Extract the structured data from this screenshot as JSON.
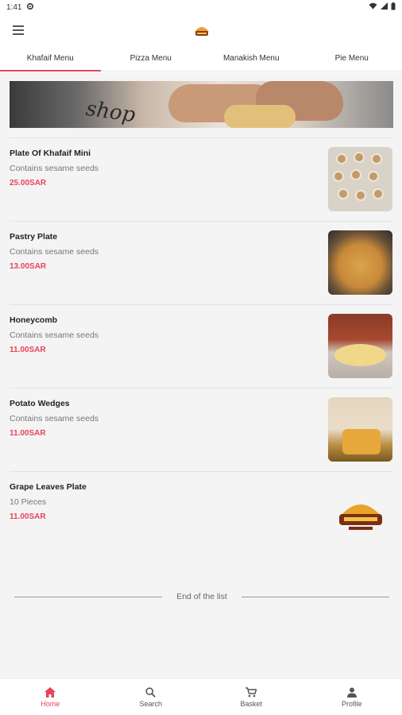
{
  "status_bar": {
    "time": "1:41"
  },
  "tabs": [
    {
      "label": "Khafaif Menu",
      "active": true
    },
    {
      "label": "Pizza Menu",
      "active": false
    },
    {
      "label": "Manakish Menu",
      "active": false
    },
    {
      "label": "Pie Menu",
      "active": false
    }
  ],
  "banner": {
    "text": "shop"
  },
  "items": [
    {
      "name": "Plate Of Khafaif Mini",
      "description": "Contains sesame seeds",
      "price": "25.00SAR",
      "image": "khafaif-plate"
    },
    {
      "name": "Pastry Plate",
      "description": "Contains sesame seeds",
      "price": "13.00SAR",
      "image": "pastry-plate"
    },
    {
      "name": "Honeycomb",
      "description": "Contains sesame seeds",
      "price": "11.00SAR",
      "image": "honeycomb-bread"
    },
    {
      "name": "Potato Wedges",
      "description": "Contains sesame seeds",
      "price": "11.00SAR",
      "image": "potato-wedges-box"
    },
    {
      "name": "Grape Leaves Plate",
      "description": "10 Pieces",
      "price": "11.00SAR",
      "image": "restaurant-logo"
    }
  ],
  "end_of_list": "End of the list",
  "bottom_nav": [
    {
      "label": "Home",
      "icon": "home-icon",
      "active": true
    },
    {
      "label": "Search",
      "icon": "search-icon",
      "active": false
    },
    {
      "label": "Basket",
      "icon": "cart-icon",
      "active": false
    },
    {
      "label": "Profile",
      "icon": "person-icon",
      "active": false
    }
  ],
  "colors": {
    "accent": "#e8435a",
    "background": "#f4f4f4"
  }
}
